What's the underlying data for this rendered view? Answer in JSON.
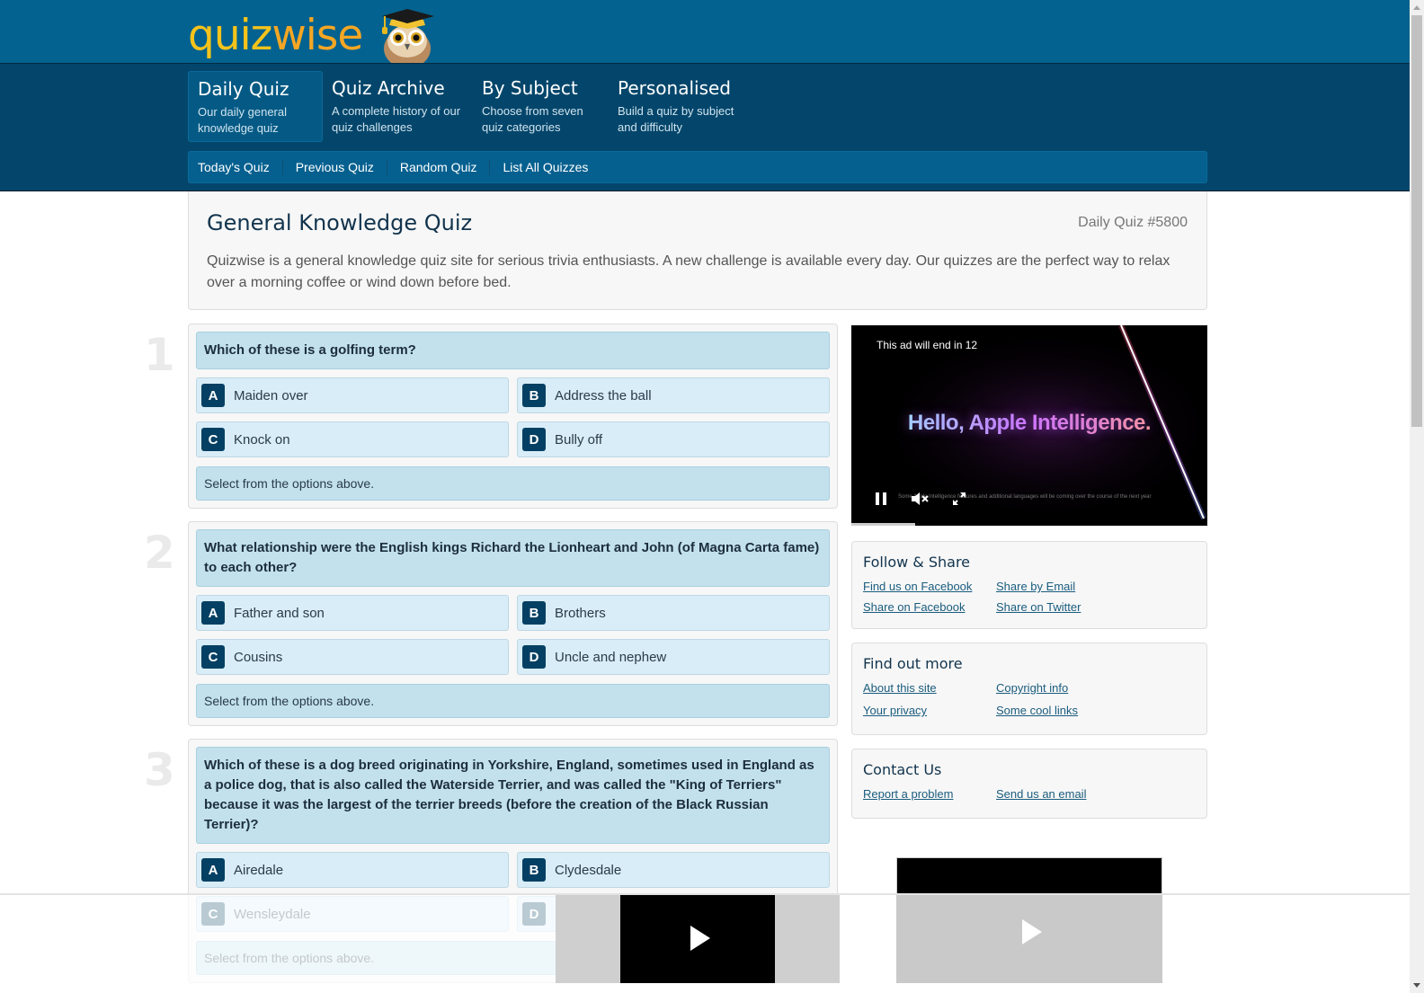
{
  "brand": {
    "logo_part1": "quiz",
    "logo_part2": "wise",
    "colors": {
      "header": "#03628f",
      "nav": "#04466b",
      "accent": "#f6c31b",
      "letter_badge": "#044063",
      "question_bg": "#c2e1ed",
      "answer_bg": "#d8edf7"
    }
  },
  "main_nav": [
    {
      "title": "Daily Quiz",
      "desc": "Our daily general knowledge quiz",
      "active": true
    },
    {
      "title": "Quiz Archive",
      "desc": "A complete history of our quiz challenges",
      "active": false
    },
    {
      "title": "By Subject",
      "desc": "Choose from seven quiz categories",
      "active": false
    },
    {
      "title": "Personalised",
      "desc": "Build a quiz by subject and difficulty",
      "active": false
    }
  ],
  "sub_nav": [
    "Today's Quiz",
    "Previous Quiz",
    "Random Quiz",
    "List All Quizzes"
  ],
  "intro": {
    "title": "General Knowledge Quiz",
    "badge": "Daily Quiz #5800",
    "text": "Quizwise is a general knowledge quiz site for serious trivia enthusiasts. A new challenge is available every day. Our quizzes are the perfect way to relax over a morning coffee or wind down before bed."
  },
  "questions": [
    {
      "number": "1",
      "text": "Which of these is a golfing term?",
      "answers": [
        {
          "letter": "A",
          "text": "Maiden over"
        },
        {
          "letter": "B",
          "text": "Address the ball"
        },
        {
          "letter": "C",
          "text": "Knock on"
        },
        {
          "letter": "D",
          "text": "Bully off"
        }
      ],
      "status": "Select from the options above."
    },
    {
      "number": "2",
      "text": "What relationship were the English kings Richard the Lionheart and John (of Magna Carta fame) to each other?",
      "answers": [
        {
          "letter": "A",
          "text": "Father and son"
        },
        {
          "letter": "B",
          "text": "Brothers"
        },
        {
          "letter": "C",
          "text": "Cousins"
        },
        {
          "letter": "D",
          "text": "Uncle and nephew"
        }
      ],
      "status": "Select from the options above."
    },
    {
      "number": "3",
      "text": "Which of these is a dog breed originating in Yorkshire, England, sometimes used in England as a police dog, that is also called the Waterside Terrier, and was called the \"King of Terriers\" because it was the largest of the terrier breeds (before the creation of the Black Russian Terrier)?",
      "answers": [
        {
          "letter": "A",
          "text": "Airedale"
        },
        {
          "letter": "B",
          "text": "Clydesdale"
        },
        {
          "letter": "C",
          "text": "Wensleydale"
        },
        {
          "letter": "D",
          "text": ""
        }
      ],
      "status": "Select from the options above."
    }
  ],
  "ad": {
    "countdown": "This ad will end in 12",
    "headline": "Hello, Apple Intelligence.",
    "fineprint": "Some Apple Intelligence features and additional languages will be coming over the course of the next year",
    "progress_percent": 18
  },
  "side_boxes": [
    {
      "title": "Follow & Share",
      "links": [
        "Find us on Facebook",
        "Share by Email",
        "Share on Facebook",
        "Share on Twitter"
      ]
    },
    {
      "title": "Find out more",
      "links": [
        "About this site",
        "Copyright info",
        "Your privacy",
        "Some cool links"
      ]
    },
    {
      "title": "Contact Us",
      "links": [
        "Report a problem",
        "Send us an email"
      ]
    }
  ]
}
